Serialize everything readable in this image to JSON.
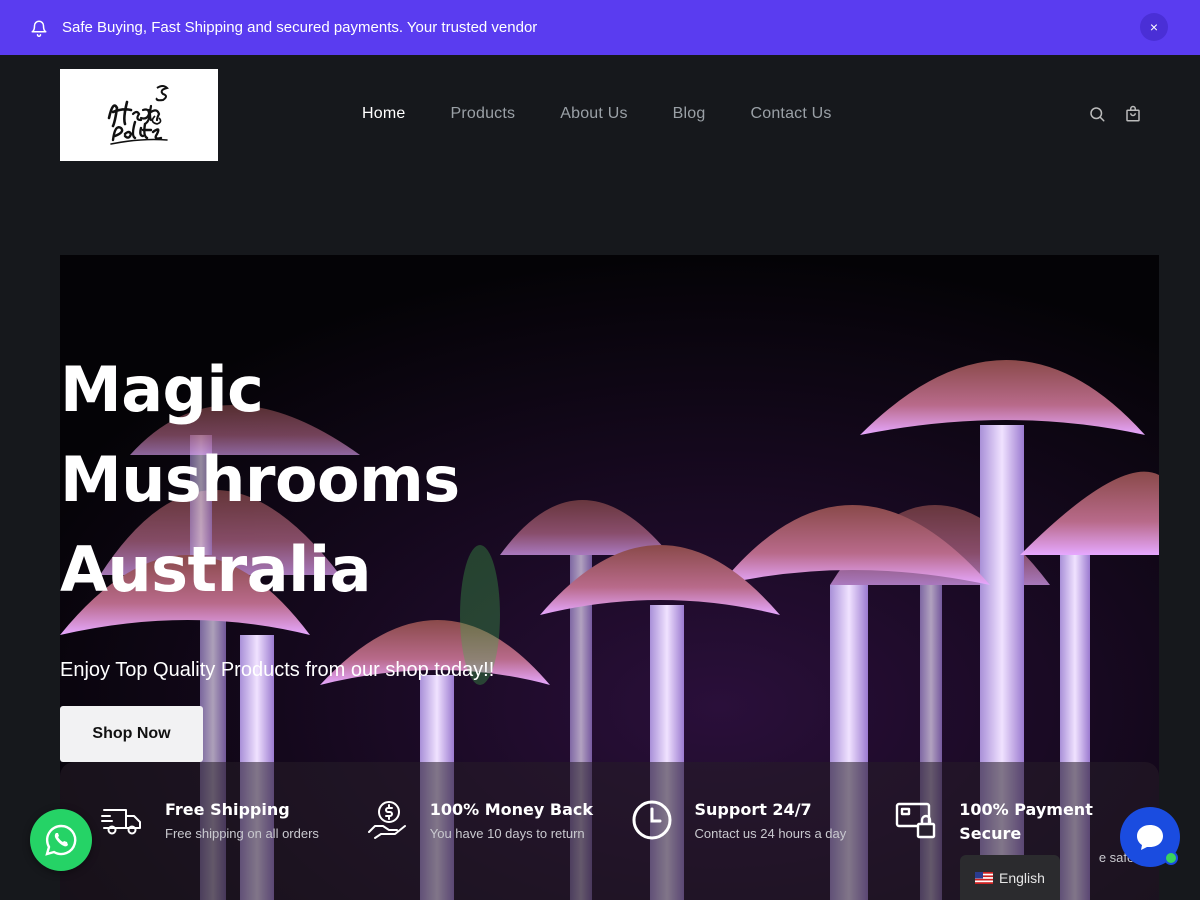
{
  "announcement": {
    "text": "Safe Buying, Fast Shipping and secured payments. Your trusted vendor",
    "close_label": "×"
  },
  "header": {
    "logo_alt": "High & Polite",
    "nav": [
      {
        "label": "Home",
        "active": true
      },
      {
        "label": "Products"
      },
      {
        "label": "About Us"
      },
      {
        "label": "Blog"
      },
      {
        "label": "Contact Us"
      }
    ]
  },
  "hero": {
    "title_lines": [
      "Magic",
      "Mushrooms",
      "Australia"
    ],
    "subtitle": "Enjoy Top Quality Products from our shop today!!",
    "cta_label": "Shop Now"
  },
  "features": [
    {
      "icon": "truck-icon",
      "title": "Free Shipping",
      "desc": "Free shipping on all orders"
    },
    {
      "icon": "money-hand-icon",
      "title": "100% Money Back",
      "desc": "You have 10 days to return"
    },
    {
      "icon": "clock-icon",
      "title": "Support 24/7",
      "desc": "Contact us 24 hours a day"
    },
    {
      "icon": "secure-payment-icon",
      "title": "100% Payment Secure",
      "desc": "e safe"
    }
  ],
  "language": {
    "label": "English"
  },
  "colors": {
    "announcement_bg": "#5a3cf0",
    "page_bg": "#16181c",
    "whatsapp": "#25d366",
    "chat": "#1a4ce0"
  }
}
